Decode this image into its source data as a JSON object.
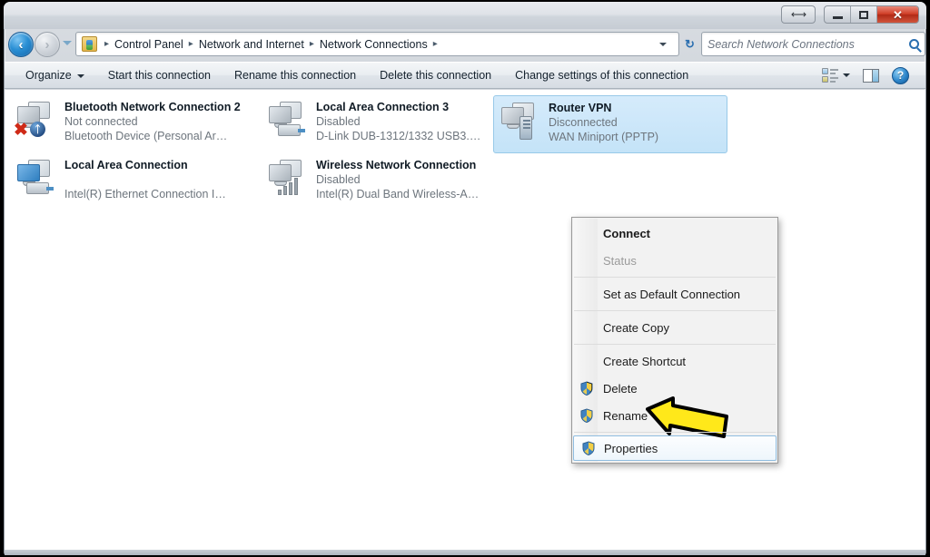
{
  "window": {
    "titlebar_buttons": [
      {
        "name": "resize-help",
        "glyph": "↔"
      },
      {
        "name": "minimize",
        "glyph": "—"
      },
      {
        "name": "maximize",
        "glyph": "□"
      },
      {
        "name": "close",
        "glyph": "✕"
      }
    ]
  },
  "address_bar": {
    "back_glyph": "←",
    "forward_glyph": "→",
    "crumbs": [
      "Control Panel",
      "Network and Internet",
      "Network Connections"
    ],
    "separator": "▸",
    "refresh_glyph": "↺"
  },
  "search": {
    "placeholder": "Search Network Connections",
    "icon": "search-icon"
  },
  "toolbar": {
    "organize": "Organize",
    "items": [
      "Start this connection",
      "Rename this connection",
      "Delete this connection",
      "Change settings of this connection"
    ],
    "right_icons": [
      "view-layout-icon",
      "preview-pane-icon",
      "help-icon"
    ],
    "help_glyph": "?"
  },
  "connections": [
    {
      "name": "Bluetooth Network Connection 2",
      "status": "Not connected",
      "device": "Bluetooth Device (Personal Area ...",
      "icon": "bluetooth-network-icon",
      "state": "not-connected",
      "selected": false
    },
    {
      "name": "Local Area Connection 3",
      "status": "Disabled",
      "device": "D-Link DUB-1312/1332 USB3.0 to ...",
      "icon": "ethernet-adapter-icon",
      "state": "disabled",
      "selected": false
    },
    {
      "name": "Router VPN",
      "status": "Disconnected",
      "device": "WAN Miniport (PPTP)",
      "icon": "vpn-connection-icon",
      "state": "disconnected",
      "selected": true
    },
    {
      "name": "Local Area Connection",
      "status": "",
      "device": "Intel(R) Ethernet Connection I218...",
      "icon": "ethernet-adapter-icon",
      "state": "connected",
      "selected": false
    },
    {
      "name": "Wireless Network Connection",
      "status": "Disabled",
      "device": "Intel(R) Dual Band Wireless-AC 72...",
      "icon": "wireless-network-icon",
      "state": "disabled",
      "selected": false
    }
  ],
  "context_menu": {
    "items": [
      {
        "label": "Connect",
        "style": "bold",
        "shield": false,
        "separator_after": false
      },
      {
        "label": "Status",
        "style": "disabled",
        "shield": false,
        "separator_after": true
      },
      {
        "label": "Set as Default Connection",
        "style": "normal",
        "shield": false,
        "separator_after": true
      },
      {
        "label": "Create Copy",
        "style": "normal",
        "shield": false,
        "separator_after": true
      },
      {
        "label": "Create Shortcut",
        "style": "normal",
        "shield": false,
        "separator_after": false
      },
      {
        "label": "Delete",
        "style": "normal",
        "shield": true,
        "separator_after": false
      },
      {
        "label": "Rename",
        "style": "normal",
        "shield": true,
        "separator_after": true
      },
      {
        "label": "Properties",
        "style": "hover",
        "shield": true,
        "separator_after": false
      }
    ]
  },
  "cursor": {
    "name": "pointer-arrow",
    "color": "#ffe81a"
  },
  "colors": {
    "accent": "#2a6fb0",
    "selection": "#c4e3f8",
    "close_button": "#cf3c25",
    "status_text": "#6d757d"
  }
}
